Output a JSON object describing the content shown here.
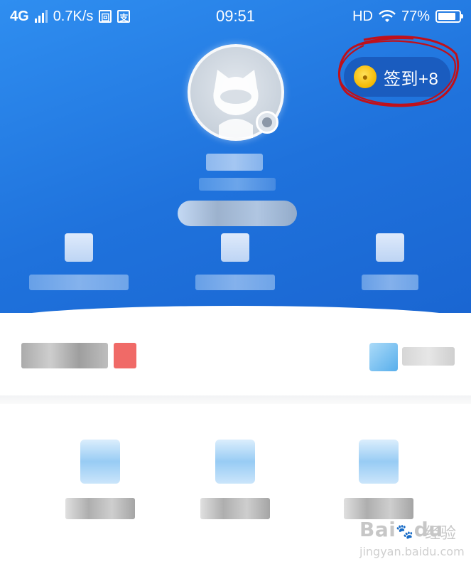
{
  "status_bar": {
    "network": "4G",
    "speed": "0.7K/s",
    "app_icon_1": "回",
    "app_icon_2": "支",
    "time": "09:51",
    "hd": "HD",
    "battery_percent": "77%",
    "battery_level": 0.77
  },
  "profile": {
    "avatar_icon": "cat-avatar-icon",
    "checkin_label": "签到+8",
    "coin_icon": "coin-icon",
    "highlight_color": "#c0101a"
  },
  "colors": {
    "header_blue": "#1f72dc",
    "checkin_bg": "#1a5cbf",
    "coin_gold": "#f5b800",
    "badge_red": "#ee5a56"
  },
  "watermark": {
    "brand": "Bai",
    "paw": "du",
    "cn": "经验",
    "url": "jingyan.baidu.com"
  }
}
